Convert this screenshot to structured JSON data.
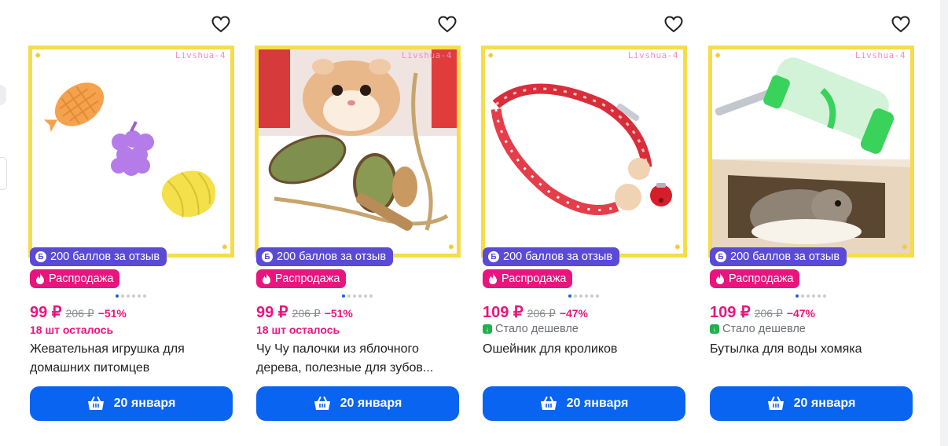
{
  "products": [
    {
      "watermark": "Livshua-4",
      "bonus_label": "200 баллов за отзыв",
      "sale_label": "Распродажа",
      "price": "99 ₽",
      "old_price": "206 ₽",
      "discount": "−51%",
      "stock": "18 шт осталось",
      "title": "Жевательная игрушка для домашних питомцев",
      "delivery": "20 января",
      "carousel_dots": 6,
      "carousel_active_index": 0
    },
    {
      "watermark": "Livshua-4",
      "bonus_label": "200 баллов за отзыв",
      "sale_label": "Распродажа",
      "price": "99 ₽",
      "old_price": "206 ₽",
      "discount": "−51%",
      "stock": "18 шт осталось",
      "title": "Чу Чу палочки из яблочного дерева, полезные для зубов...",
      "delivery": "20 января",
      "carousel_dots": 6,
      "carousel_active_index": 0
    },
    {
      "watermark": "Livshua-4",
      "bonus_label": "200 баллов за отзыв",
      "sale_label": "Распродажа",
      "price": "109 ₽",
      "old_price": "206 ₽",
      "discount": "−47%",
      "price_note": "Стало дешевле",
      "title": "Ошейник для кроликов",
      "delivery": "20 января",
      "carousel_dots": 6,
      "carousel_active_index": 0
    },
    {
      "watermark": "Livshua-4",
      "bonus_label": "200 баллов за отзыв",
      "sale_label": "Распродажа",
      "price": "109 ₽",
      "old_price": "206 ₽",
      "discount": "−47%",
      "price_note": "Стало дешевле",
      "title": "Бутылка для воды хомяка",
      "delivery": "20 января",
      "carousel_dots": 6,
      "carousel_active_index": 0
    }
  ],
  "colors": {
    "price": "#e8157e",
    "bonus_badge": "#5a4ad6",
    "sale_badge": "#e8157e",
    "button": "#0a64f2",
    "photo_frame": "#f6dc4a",
    "cheaper_icon": "#1fb14b"
  },
  "icons": {
    "favorite": "heart-outline-icon",
    "bonus": "bonus-coin-icon",
    "sale": "fire-icon",
    "cheaper": "arrow-down-icon",
    "cart": "basket-icon"
  }
}
